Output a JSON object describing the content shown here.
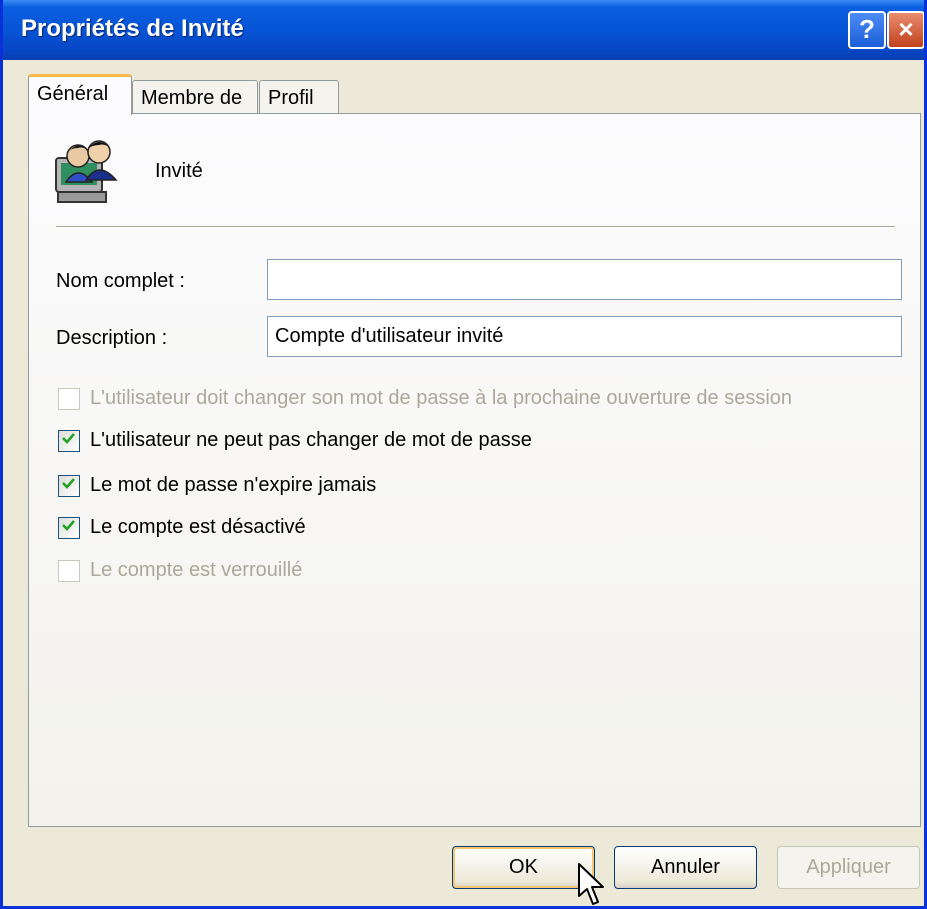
{
  "window": {
    "title": "Propriétés de Invité",
    "help_button": "?",
    "close_button": "×"
  },
  "tabs": [
    {
      "label": "Général",
      "active": true
    },
    {
      "label": "Membre de",
      "active": false
    },
    {
      "label": "Profil",
      "active": false
    }
  ],
  "general": {
    "user_icon": "users-icon",
    "username": "Invité",
    "full_name": {
      "label": "Nom complet :",
      "value": ""
    },
    "description": {
      "label": "Description :",
      "value": "Compte d'utilisateur invité"
    },
    "options": [
      {
        "label": "L'utilisateur doit changer son mot de passe à la prochaine ouverture de session",
        "checked": false,
        "enabled": false
      },
      {
        "label": "L'utilisateur ne peut pas changer de mot de passe",
        "checked": true,
        "enabled": true
      },
      {
        "label": "Le mot de passe n'expire jamais",
        "checked": true,
        "enabled": true
      },
      {
        "label": "Le compte est désactivé",
        "checked": true,
        "enabled": true
      },
      {
        "label": "Le compte est verrouillé",
        "checked": false,
        "enabled": false
      }
    ]
  },
  "buttons": {
    "ok": "OK",
    "cancel": "Annuler",
    "apply": "Appliquer"
  },
  "colors": {
    "title_bar": "#0754d6",
    "face": "#ece9d8",
    "check": "#21a121",
    "disabled_text": "#aca899"
  }
}
